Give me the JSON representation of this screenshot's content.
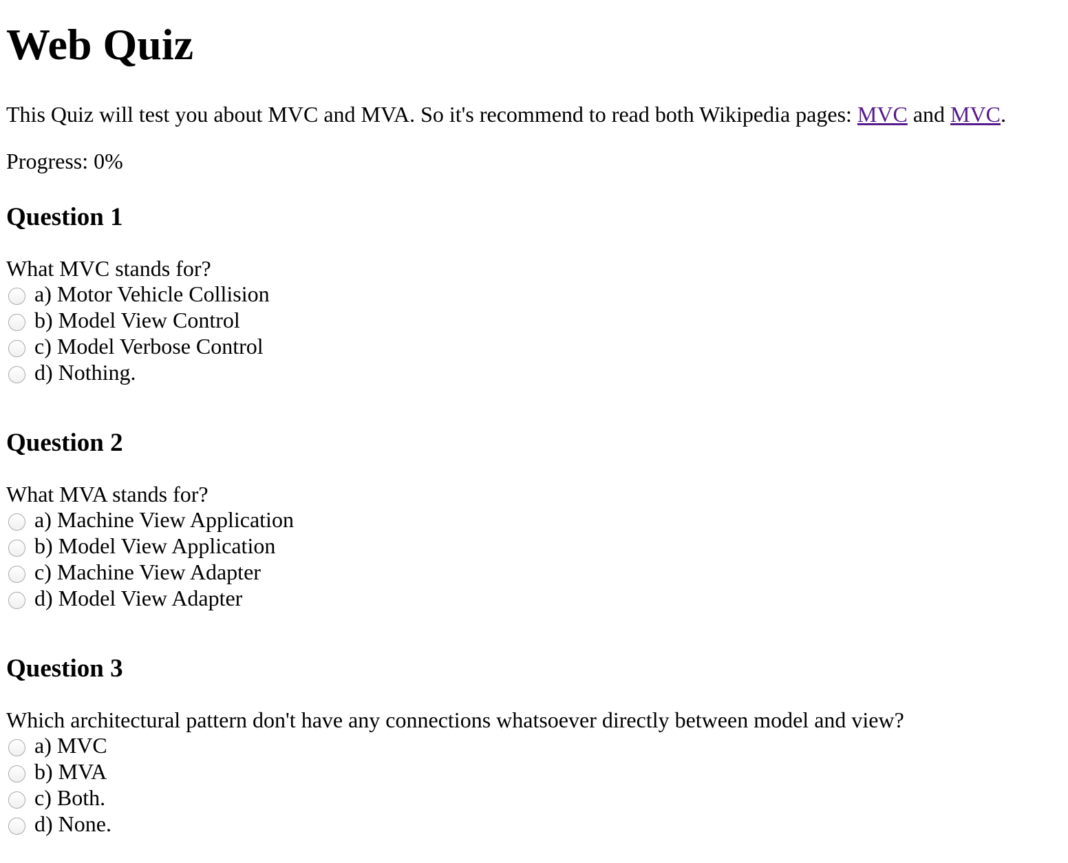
{
  "page": {
    "title": "Web Quiz",
    "intro_text": "This Quiz will test you about MVC and MVA. So it's recommend to read both Wikipedia pages: ",
    "link1_label": "MVC",
    "intro_and": " and ",
    "link2_label": "MVC",
    "intro_end": ".",
    "progress_label": "Progress: ",
    "progress_value": "0%"
  },
  "questions": [
    {
      "heading": "Question 1",
      "text": "What MVC stands for?",
      "options": [
        "a) Motor Vehicle Collision",
        "b) Model View Control",
        "c) Model Verbose Control",
        "d) Nothing."
      ]
    },
    {
      "heading": "Question 2",
      "text": "What MVA stands for?",
      "options": [
        "a) Machine View Application",
        "b) Model View Application",
        "c) Machine View Adapter",
        "d) Model View Adapter"
      ]
    },
    {
      "heading": "Question 3",
      "text": "Which architectural pattern don't have any connections whatsoever directly between model and view?",
      "options": [
        "a) MVC",
        "b) MVA",
        "c) Both.",
        "d) None."
      ]
    }
  ],
  "colors": {
    "link_visited": "#551a8b",
    "text": "#000000",
    "background": "#ffffff"
  }
}
